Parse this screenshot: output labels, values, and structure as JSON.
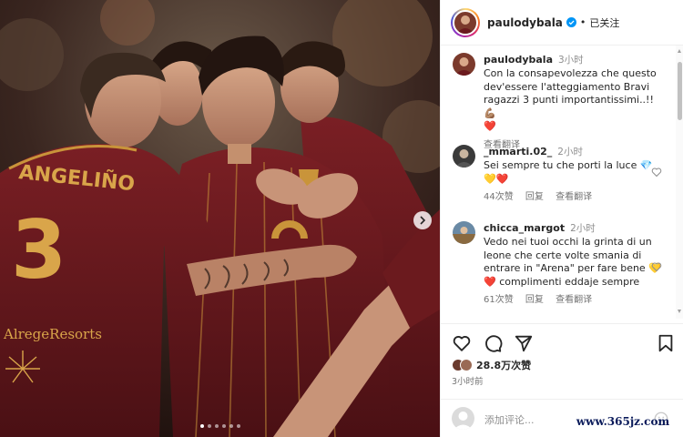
{
  "post": {
    "username": "paulodybala",
    "follow_label": "已关注",
    "separator": "•",
    "likes": "28.8万次赞",
    "posted_time": "3小时前",
    "add_comment_placeholder": "添加评论...",
    "carousel": {
      "slide_count": 6,
      "active_index": 0
    }
  },
  "caption": {
    "author": "paulodybala",
    "time": "3小时",
    "text": "Con la consapevolezza che questo dev'essere l'atteggiamento Bravi ragazzi 3 punti importantissimi..!! 💪🏽\n❤️",
    "translate": "查看翻译"
  },
  "comments": [
    {
      "author": "_mmarti.02_",
      "time": "2小时",
      "text": "Sei sempre tu che porti la luce 💎\n💛❤️",
      "likes": "44次赞",
      "reply": "回复",
      "translate": "查看翻译"
    },
    {
      "author": "chicca_margot",
      "time": "2小时",
      "text": "Vedo nei tuoi occhi la grinta di un leone che certe volte smania di entrare in \"Arena\" per fare bene 💛❤️ complimenti eddaje sempre",
      "likes": "61次赞",
      "reply": "回复",
      "translate": "查看翻译"
    }
  ],
  "photo": {
    "jersey_name": "ANGELIÑO",
    "jersey_number": "3",
    "sponsor": "AlregeResorts"
  },
  "watermark": "www.365jz.com",
  "colors": {
    "jersey": "#6b1a1e",
    "jersey_trim": "#c9943a",
    "ig_text": "#262626",
    "ig_secondary": "#8e8e8e",
    "verified_blue": "#0095f6",
    "heart_red": "#ed4956"
  }
}
